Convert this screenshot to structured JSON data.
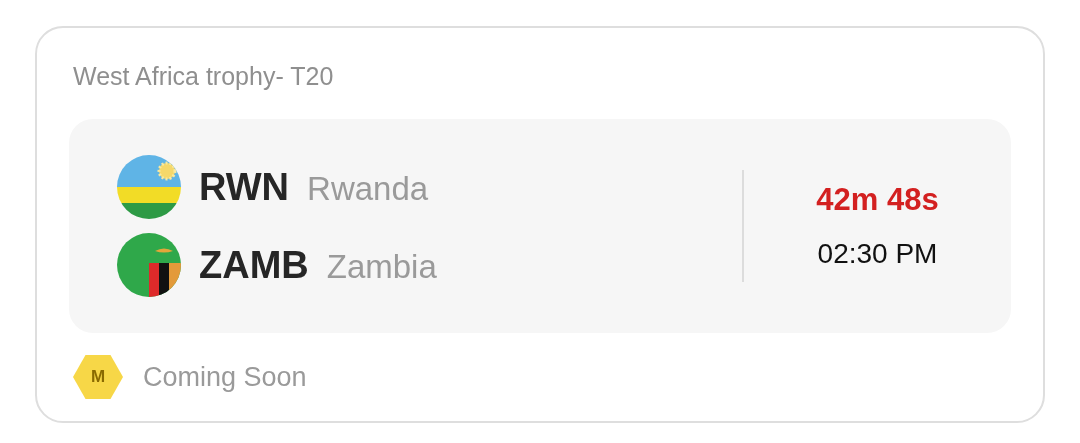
{
  "title": "West Africa trophy- T20",
  "teams": [
    {
      "code": "RWN",
      "name": "Rwanda",
      "kind": "rwanda"
    },
    {
      "code": "ZAMB",
      "name": "Zambia",
      "kind": "zambia"
    }
  ],
  "countdown": "42m 48s",
  "start_time": "02:30 PM",
  "footer": {
    "badge": "M",
    "status": "Coming Soon"
  }
}
